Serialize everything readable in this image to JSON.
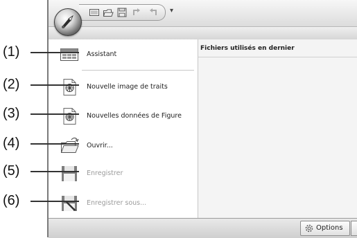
{
  "callouts": [
    "(1)",
    "(2)",
    "(3)",
    "(4)",
    "(5)",
    "(6)"
  ],
  "menu": {
    "items": [
      {
        "label": "Assistant",
        "icon": "wizard-icon",
        "enabled": true
      },
      {
        "label": "Nouvelle image de traits",
        "icon": "new-line-image-icon",
        "enabled": true
      },
      {
        "label": "Nouvelles données de Figure",
        "icon": "new-figure-data-icon",
        "enabled": true
      },
      {
        "label": "Ouvrir...",
        "icon": "open-folder-icon",
        "enabled": true
      },
      {
        "label": "Enregistrer",
        "icon": "save-icon",
        "enabled": false
      },
      {
        "label": "Enregistrer sous...",
        "icon": "save-as-icon",
        "enabled": false
      }
    ]
  },
  "recent": {
    "title": "Fichiers utilisés en dernier"
  },
  "footer": {
    "options_label": "Options"
  },
  "quick_access": {
    "icons": [
      "new-icon",
      "open-icon",
      "save-icon",
      "undo-icon",
      "redo-icon",
      "customize-dropdown-icon"
    ]
  }
}
